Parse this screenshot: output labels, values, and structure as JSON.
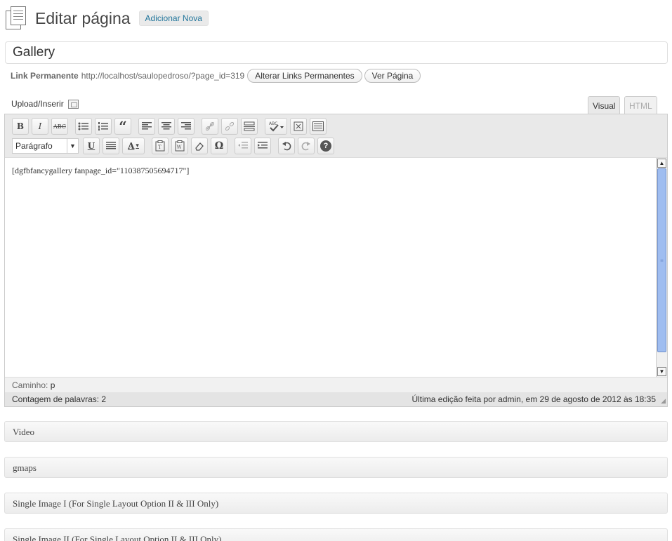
{
  "header": {
    "title": "Editar página",
    "add_new": "Adicionar Nova"
  },
  "post_title": "Gallery",
  "permalink": {
    "label": "Link Permanente",
    "url": "http://localhost/saulopedroso/?page_id=319",
    "change_button": "Alterar Links Permanentes",
    "view_button": "Ver Página"
  },
  "upload_label": "Upload/Inserir",
  "tabs": {
    "visual": "Visual",
    "html": "HTML"
  },
  "toolbar": {
    "format_value": "Parágrafo",
    "bold": "B",
    "italic": "I",
    "strike": "ABC",
    "blockquote": "“",
    "underline": "U",
    "forecolor": "A",
    "charmap": "Ω",
    "help": "?"
  },
  "content_text": "[dgfbfancygallery  fanpage_id=\"110387505694717\"]",
  "status": {
    "path_label": "Caminho:",
    "path_value": "p",
    "word_count": "Contagem de palavras: 2",
    "last_edit": "Última edição feita por admin, em 29 de agosto de 2012 às 18:35"
  },
  "meta_boxes": [
    "Video",
    "gmaps",
    "Single Image I (For Single Layout Option II & III Only)",
    "Single Image II (For Single Layout Option II & III Only)"
  ]
}
